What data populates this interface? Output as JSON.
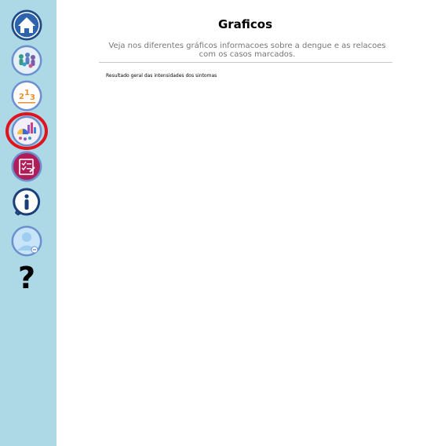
{
  "sidebar": {
    "background": "#add8e6",
    "items": [
      {
        "icon": "home-icon",
        "label": ""
      },
      {
        "icon": "community-icon",
        "label": ""
      },
      {
        "icon": "ranking-icon",
        "label": "2 1 3"
      },
      {
        "icon": "charts-icon",
        "label": "",
        "selected": true
      },
      {
        "icon": "report-icon",
        "label": ""
      },
      {
        "icon": "info-icon",
        "label": ""
      },
      {
        "icon": "profile-icon",
        "label": ""
      },
      {
        "icon": "help-icon",
        "label": "?"
      }
    ]
  },
  "main": {
    "title": "Graficos",
    "subtitle": "Veja nos diferentes gráficos informacoes sobre a dengue e as relacoes com os casos marcados.",
    "section_label": "Resultado geral das intensidades dos sintomas"
  },
  "colors": {
    "selected_ring": "#e0141e",
    "icon_navy": "#1a3f78",
    "report_magenta": "#b01e5a"
  }
}
